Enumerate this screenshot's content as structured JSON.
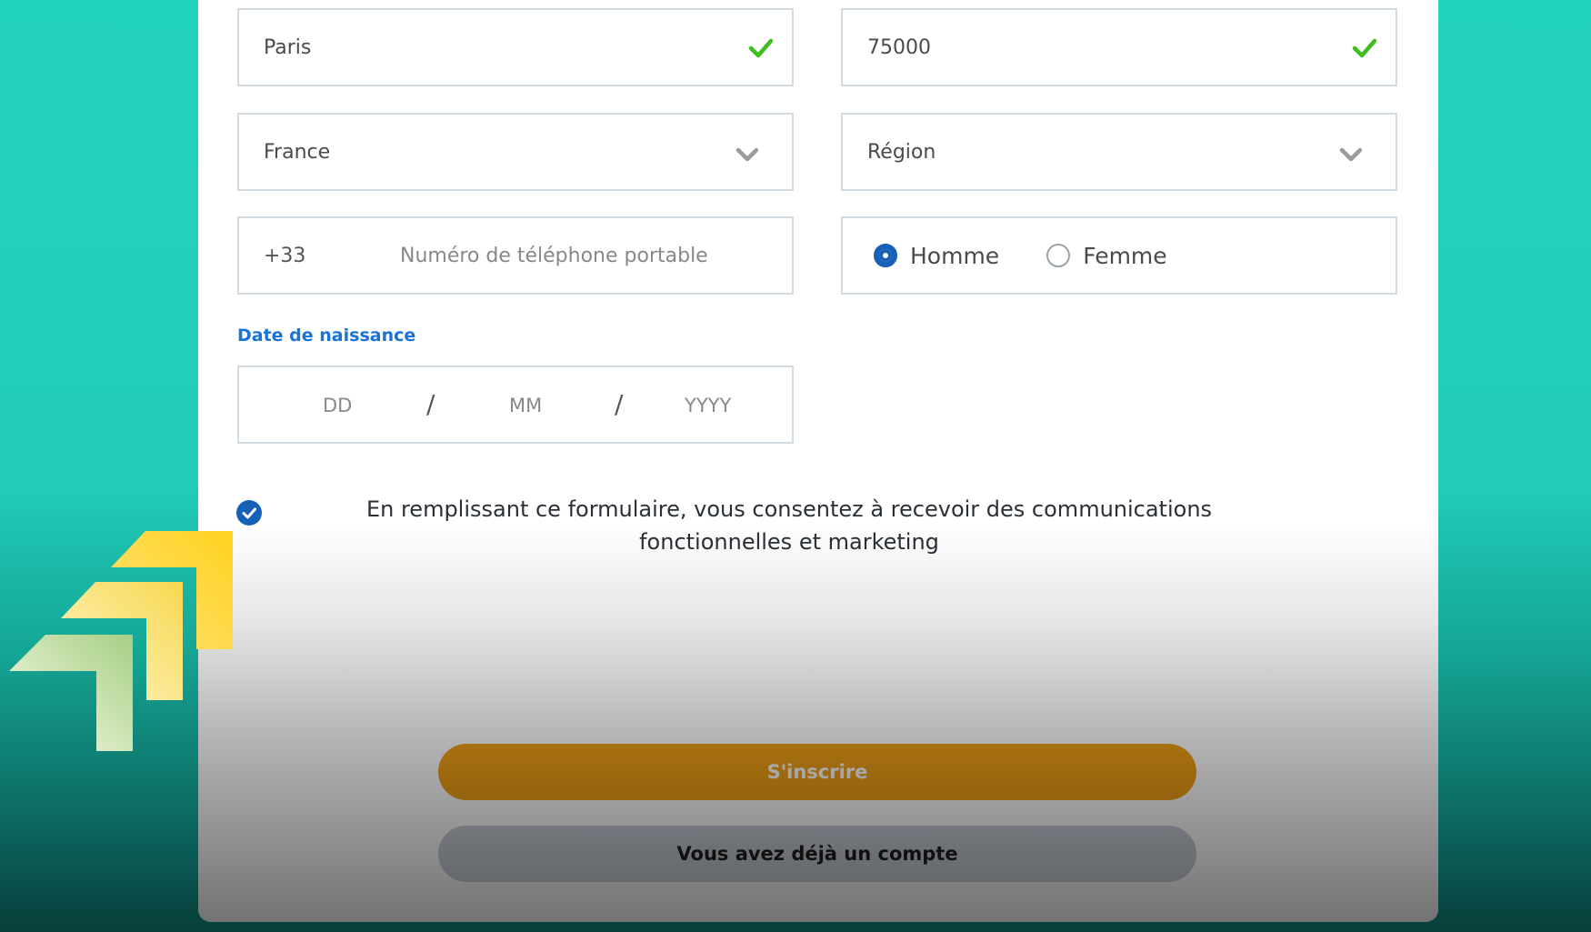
{
  "form": {
    "city": {
      "value": "Paris",
      "valid_icon": "check-icon"
    },
    "postal_code": {
      "value": "75000",
      "valid_icon": "check-icon"
    },
    "country": {
      "selected": "France",
      "icon": "chevron-down-icon"
    },
    "region": {
      "placeholder": "Région",
      "icon": "chevron-down-icon"
    },
    "phone": {
      "prefix": "+33",
      "placeholder": "Numéro de téléphone portable"
    },
    "gender": {
      "options": [
        {
          "label": "Homme",
          "checked": true
        },
        {
          "label": "Femme",
          "checked": false
        }
      ]
    },
    "birthdate": {
      "label": "Date de naissance",
      "day_placeholder": "DD",
      "month_placeholder": "MM",
      "year_placeholder": "YYYY",
      "separator": "/"
    },
    "consent": {
      "checked": true,
      "text": "En remplissant ce formulaire, vous consentez à recevoir des communications fonctionnelles et marketing"
    }
  },
  "actions": {
    "submit_label": "S'inscrire",
    "login_label": "Vous avez déjà un compte"
  },
  "colors": {
    "accent": "#1660b8",
    "label_blue": "#1a73d4",
    "valid_green": "#3fbf1f",
    "submit_orange": "#f0a016",
    "background_teal": "#22d3bf"
  }
}
